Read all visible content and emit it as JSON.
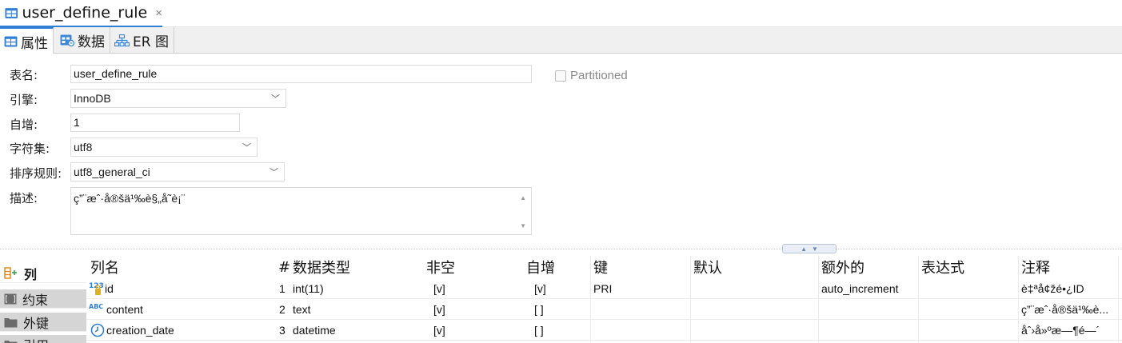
{
  "editor_tab": {
    "title": "user_define_rule",
    "close": "×"
  },
  "subtabs": [
    {
      "label": "属性"
    },
    {
      "label": "数据"
    },
    {
      "label": "ER 图"
    }
  ],
  "props": {
    "table_name_label": "表名:",
    "table_name": "user_define_rule",
    "engine_label": "引擎:",
    "engine": "InnoDB",
    "auto_inc_label": "自增:",
    "auto_inc": "1",
    "charset_label": "字符集:",
    "charset": "utf8",
    "collation_label": "排序规则:",
    "collation": "utf8_general_ci",
    "desc_label": "描述:",
    "desc": "ç”¨æˆ·å®šä¹‰è§„å˜è¡¨",
    "partitioned_label": "Partitioned"
  },
  "leftnav": [
    {
      "label": "列"
    },
    {
      "label": "约束"
    },
    {
      "label": "外键"
    },
    {
      "label": "引用"
    }
  ],
  "columns_table": {
    "headers": {
      "name": "列名",
      "num": "#",
      "type": "数据类型",
      "not_null": "非空",
      "auto_inc": "自增",
      "key": "键",
      "default": "默认",
      "extra": "额外的",
      "expression": "表达式",
      "comment": "注释"
    },
    "rows": [
      {
        "icon": "123",
        "name": "id",
        "num": "1",
        "type": "int(11)",
        "not_null": "[v]",
        "auto_inc": "[v]",
        "key": "PRI",
        "default": "",
        "extra": "auto_increment",
        "expression": "",
        "comment": "è‡ªå¢žé•¿ID"
      },
      {
        "icon": "ABC",
        "name": "content",
        "num": "2",
        "type": "text",
        "not_null": "[v]",
        "auto_inc": "[ ]",
        "key": "",
        "default": "",
        "extra": "",
        "expression": "",
        "comment": "ç”¨æˆ·å®šä¹‰è..."
      },
      {
        "icon": "clock",
        "name": "creation_date",
        "num": "3",
        "type": "datetime",
        "not_null": "[v]",
        "auto_inc": "[ ]",
        "key": "",
        "default": "",
        "extra": "",
        "expression": "",
        "comment": "åˆ›å»ºæ—¶é—´"
      }
    ]
  }
}
